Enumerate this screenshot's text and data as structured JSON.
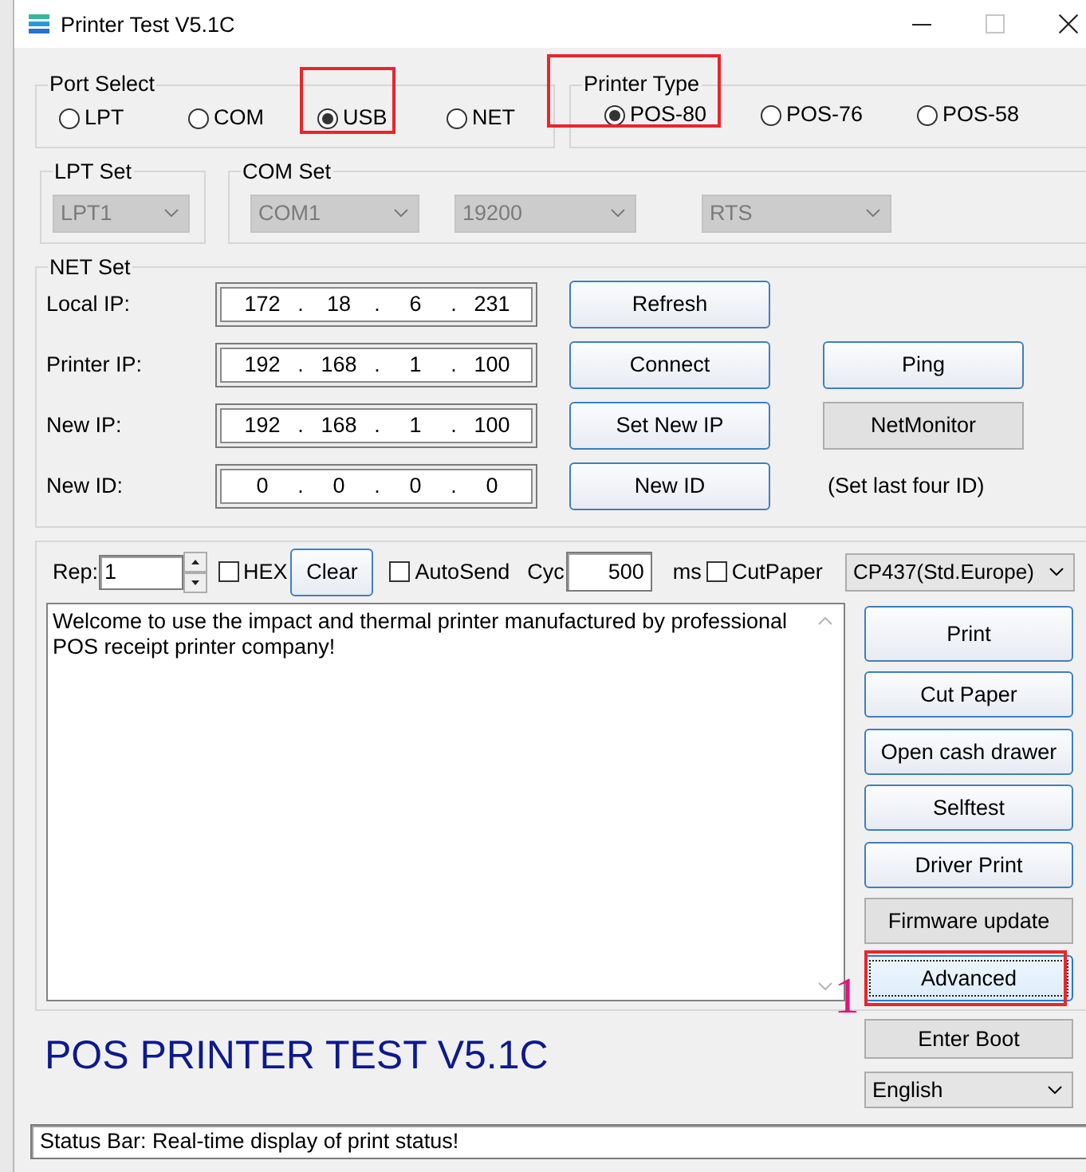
{
  "window": {
    "title": "Printer Test V5.1C",
    "controls": [
      {
        "kind": "minimize",
        "disabled": false
      },
      {
        "kind": "maximize",
        "disabled": true
      },
      {
        "kind": "close",
        "disabled": false
      }
    ]
  },
  "port_select": {
    "label": "Port Select",
    "options": [
      {
        "label": "LPT",
        "selected": false,
        "highlighted": false
      },
      {
        "label": "COM",
        "selected": false,
        "highlighted": false
      },
      {
        "label": "USB",
        "selected": true,
        "highlighted": true
      },
      {
        "label": "NET",
        "selected": false,
        "highlighted": false
      }
    ]
  },
  "printer_type": {
    "label": "Printer Type",
    "highlighted": true,
    "options": [
      {
        "label": "POS-80",
        "selected": true
      },
      {
        "label": "POS-76",
        "selected": false
      },
      {
        "label": "POS-58",
        "selected": false
      }
    ]
  },
  "lpt_set": {
    "label": "LPT Set",
    "dropdowns": [
      {
        "value": "LPT1",
        "disabled": true
      }
    ]
  },
  "com_set": {
    "label": "COM Set",
    "dropdowns": [
      {
        "value": "COM1",
        "disabled": true
      },
      {
        "value": "19200",
        "disabled": true
      },
      {
        "value": "RTS",
        "disabled": true
      }
    ]
  },
  "net_set": {
    "label": "NET Set",
    "separator": ".",
    "rows": [
      {
        "label": "Local IP:",
        "octets": [
          "172",
          "18",
          "6",
          "231"
        ],
        "button": {
          "label": "Refresh",
          "kind": "raised"
        }
      },
      {
        "label": "Printer IP:",
        "octets": [
          "192",
          "168",
          "1",
          "100"
        ],
        "button": {
          "label": "Connect",
          "kind": "raised"
        },
        "extra": {
          "kind": "raised",
          "label": "Ping"
        }
      },
      {
        "label": "New IP:",
        "octets": [
          "192",
          "168",
          "1",
          "100"
        ],
        "button": {
          "label": "Set New IP",
          "kind": "raised"
        },
        "extra": {
          "kind": "flat",
          "label": "NetMonitor"
        }
      },
      {
        "label": "New ID:",
        "octets": [
          "0",
          "0",
          "0",
          "0"
        ],
        "button": {
          "label": "New ID",
          "kind": "raised"
        },
        "extra": {
          "kind": "note",
          "label": "(Set last four ID)"
        }
      }
    ]
  },
  "toolbar": {
    "controls": [
      {
        "kind": "spinner",
        "label": "Rep:",
        "value": "1"
      },
      {
        "kind": "checkbox",
        "label": "HEX",
        "checked": false
      },
      {
        "kind": "button",
        "label": "Clear"
      },
      {
        "kind": "checkbox",
        "label": "AutoSend",
        "checked": false
      },
      {
        "kind": "number",
        "label": "Cyc",
        "value": "500",
        "unit": "ms"
      },
      {
        "kind": "checkbox",
        "label": "CutPaper",
        "checked": false
      },
      {
        "kind": "dropdown",
        "value": "CP437(Std.Europe)",
        "disabled": false
      }
    ]
  },
  "message": {
    "value": "Welcome to use the impact and thermal printer manufactured by professional POS receipt printer company!"
  },
  "commands": [
    {
      "label": "Print",
      "kind": "raised",
      "focused": false,
      "highlighted": false
    },
    {
      "label": "Cut Paper",
      "kind": "raised",
      "focused": false,
      "highlighted": false
    },
    {
      "label": "Open cash drawer",
      "kind": "raised",
      "focused": false,
      "highlighted": false
    },
    {
      "label": "Selftest",
      "kind": "raised",
      "focused": false,
      "highlighted": false
    },
    {
      "label": "Driver Print",
      "kind": "raised",
      "focused": false,
      "highlighted": false
    },
    {
      "label": "Firmware update",
      "kind": "flat",
      "focused": false,
      "highlighted": false
    },
    {
      "label": "Advanced",
      "kind": "raised",
      "focused": true,
      "highlighted": true,
      "callout": "1"
    }
  ],
  "footer": {
    "title": "POS PRINTER TEST V5.1C",
    "button": {
      "label": "Enter Boot",
      "kind": "flat"
    },
    "language": {
      "value": "English",
      "disabled": false
    }
  },
  "status_bar": {
    "value": "Status Bar: Real-time display of print status!"
  }
}
